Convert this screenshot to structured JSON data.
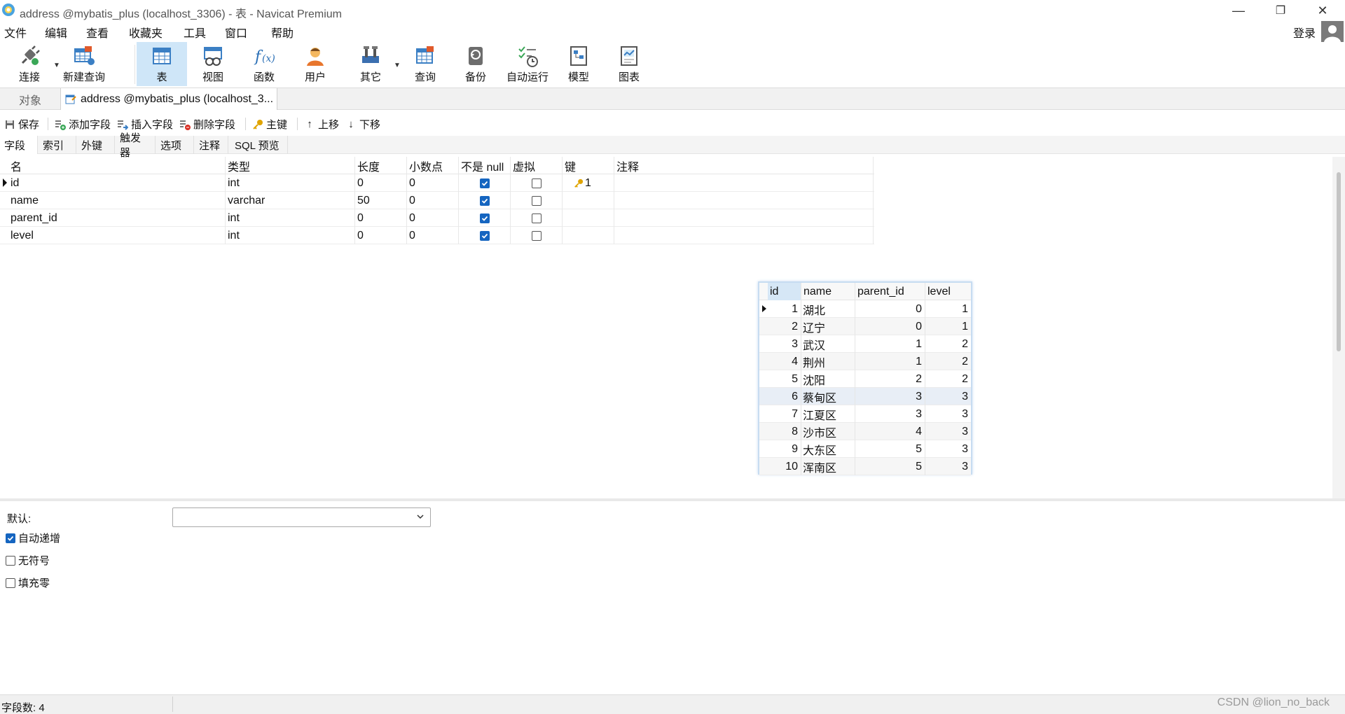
{
  "window": {
    "title": "address @mybatis_plus (localhost_3306) - 表 - Navicat Premium",
    "minimize": "—",
    "restore": "❐",
    "close": "✕"
  },
  "menu": {
    "items": [
      "文件",
      "编辑",
      "查看",
      "收藏夹",
      "工具",
      "窗口",
      "帮助"
    ],
    "login": "登录"
  },
  "toolbar": {
    "buttons": [
      {
        "label": "连接",
        "icon": "plug-icon"
      },
      {
        "label": "新建查询",
        "icon": "new-query-icon"
      },
      {
        "label": "表",
        "icon": "table-icon"
      },
      {
        "label": "视图",
        "icon": "view-icon"
      },
      {
        "label": "函数",
        "icon": "function-icon"
      },
      {
        "label": "用户",
        "icon": "user-icon"
      },
      {
        "label": "其它",
        "icon": "tools-icon"
      },
      {
        "label": "查询",
        "icon": "query-icon"
      },
      {
        "label": "备份",
        "icon": "backup-icon"
      },
      {
        "label": "自动运行",
        "icon": "schedule-icon"
      },
      {
        "label": "模型",
        "icon": "model-icon"
      },
      {
        "label": "图表",
        "icon": "chart-icon"
      }
    ],
    "active": "表"
  },
  "tabs": {
    "objects": "对象",
    "document": "address @mybatis_plus (localhost_3..."
  },
  "subtoolbar": {
    "save": "保存",
    "add_field": "添加字段",
    "insert_field": "插入字段",
    "delete_field": "删除字段",
    "primary_key": "主键",
    "move_up": "上移",
    "move_down": "下移"
  },
  "inner_tabs": [
    "字段",
    "索引",
    "外键",
    "触发器",
    "选项",
    "注释",
    "SQL 预览"
  ],
  "fields": {
    "columns": [
      "名",
      "类型",
      "长度",
      "小数点",
      "不是 null",
      "虚拟",
      "键",
      "注释"
    ],
    "rows": [
      {
        "name": "id",
        "type": "int",
        "length": "0",
        "decimals": "0",
        "not_null": true,
        "virtual": false,
        "key": "1"
      },
      {
        "name": "name",
        "type": "varchar",
        "length": "50",
        "decimals": "0",
        "not_null": true,
        "virtual": false,
        "key": ""
      },
      {
        "name": "parent_id",
        "type": "int",
        "length": "0",
        "decimals": "0",
        "not_null": true,
        "virtual": false,
        "key": ""
      },
      {
        "name": "level",
        "type": "int",
        "length": "0",
        "decimals": "0",
        "not_null": true,
        "virtual": false,
        "key": ""
      }
    ]
  },
  "data_table": {
    "columns": [
      "id",
      "name",
      "parent_id",
      "level"
    ],
    "rows": [
      [
        "1",
        "湖北",
        "0",
        "1"
      ],
      [
        "2",
        "辽宁",
        "0",
        "1"
      ],
      [
        "3",
        "武汉",
        "1",
        "2"
      ],
      [
        "4",
        "荆州",
        "1",
        "2"
      ],
      [
        "5",
        "沈阳",
        "2",
        "2"
      ],
      [
        "6",
        "蔡甸区",
        "3",
        "3"
      ],
      [
        "7",
        "江夏区",
        "3",
        "3"
      ],
      [
        "8",
        "沙市区",
        "4",
        "3"
      ],
      [
        "9",
        "大东区",
        "5",
        "3"
      ],
      [
        "10",
        "浑南区",
        "5",
        "3"
      ]
    ]
  },
  "properties": {
    "default_label": "默认:",
    "default_value": "",
    "options": [
      {
        "label": "自动递增",
        "checked": true
      },
      {
        "label": "无符号",
        "checked": false
      },
      {
        "label": "填充零",
        "checked": false
      }
    ]
  },
  "status": {
    "field_count": "字段数: 4",
    "watermark": "CSDN @lion_no_back"
  },
  "colors": {
    "accent": "#1565c0",
    "active_toolbar": "#cfe6f8",
    "key_icon": "#e0a400"
  }
}
